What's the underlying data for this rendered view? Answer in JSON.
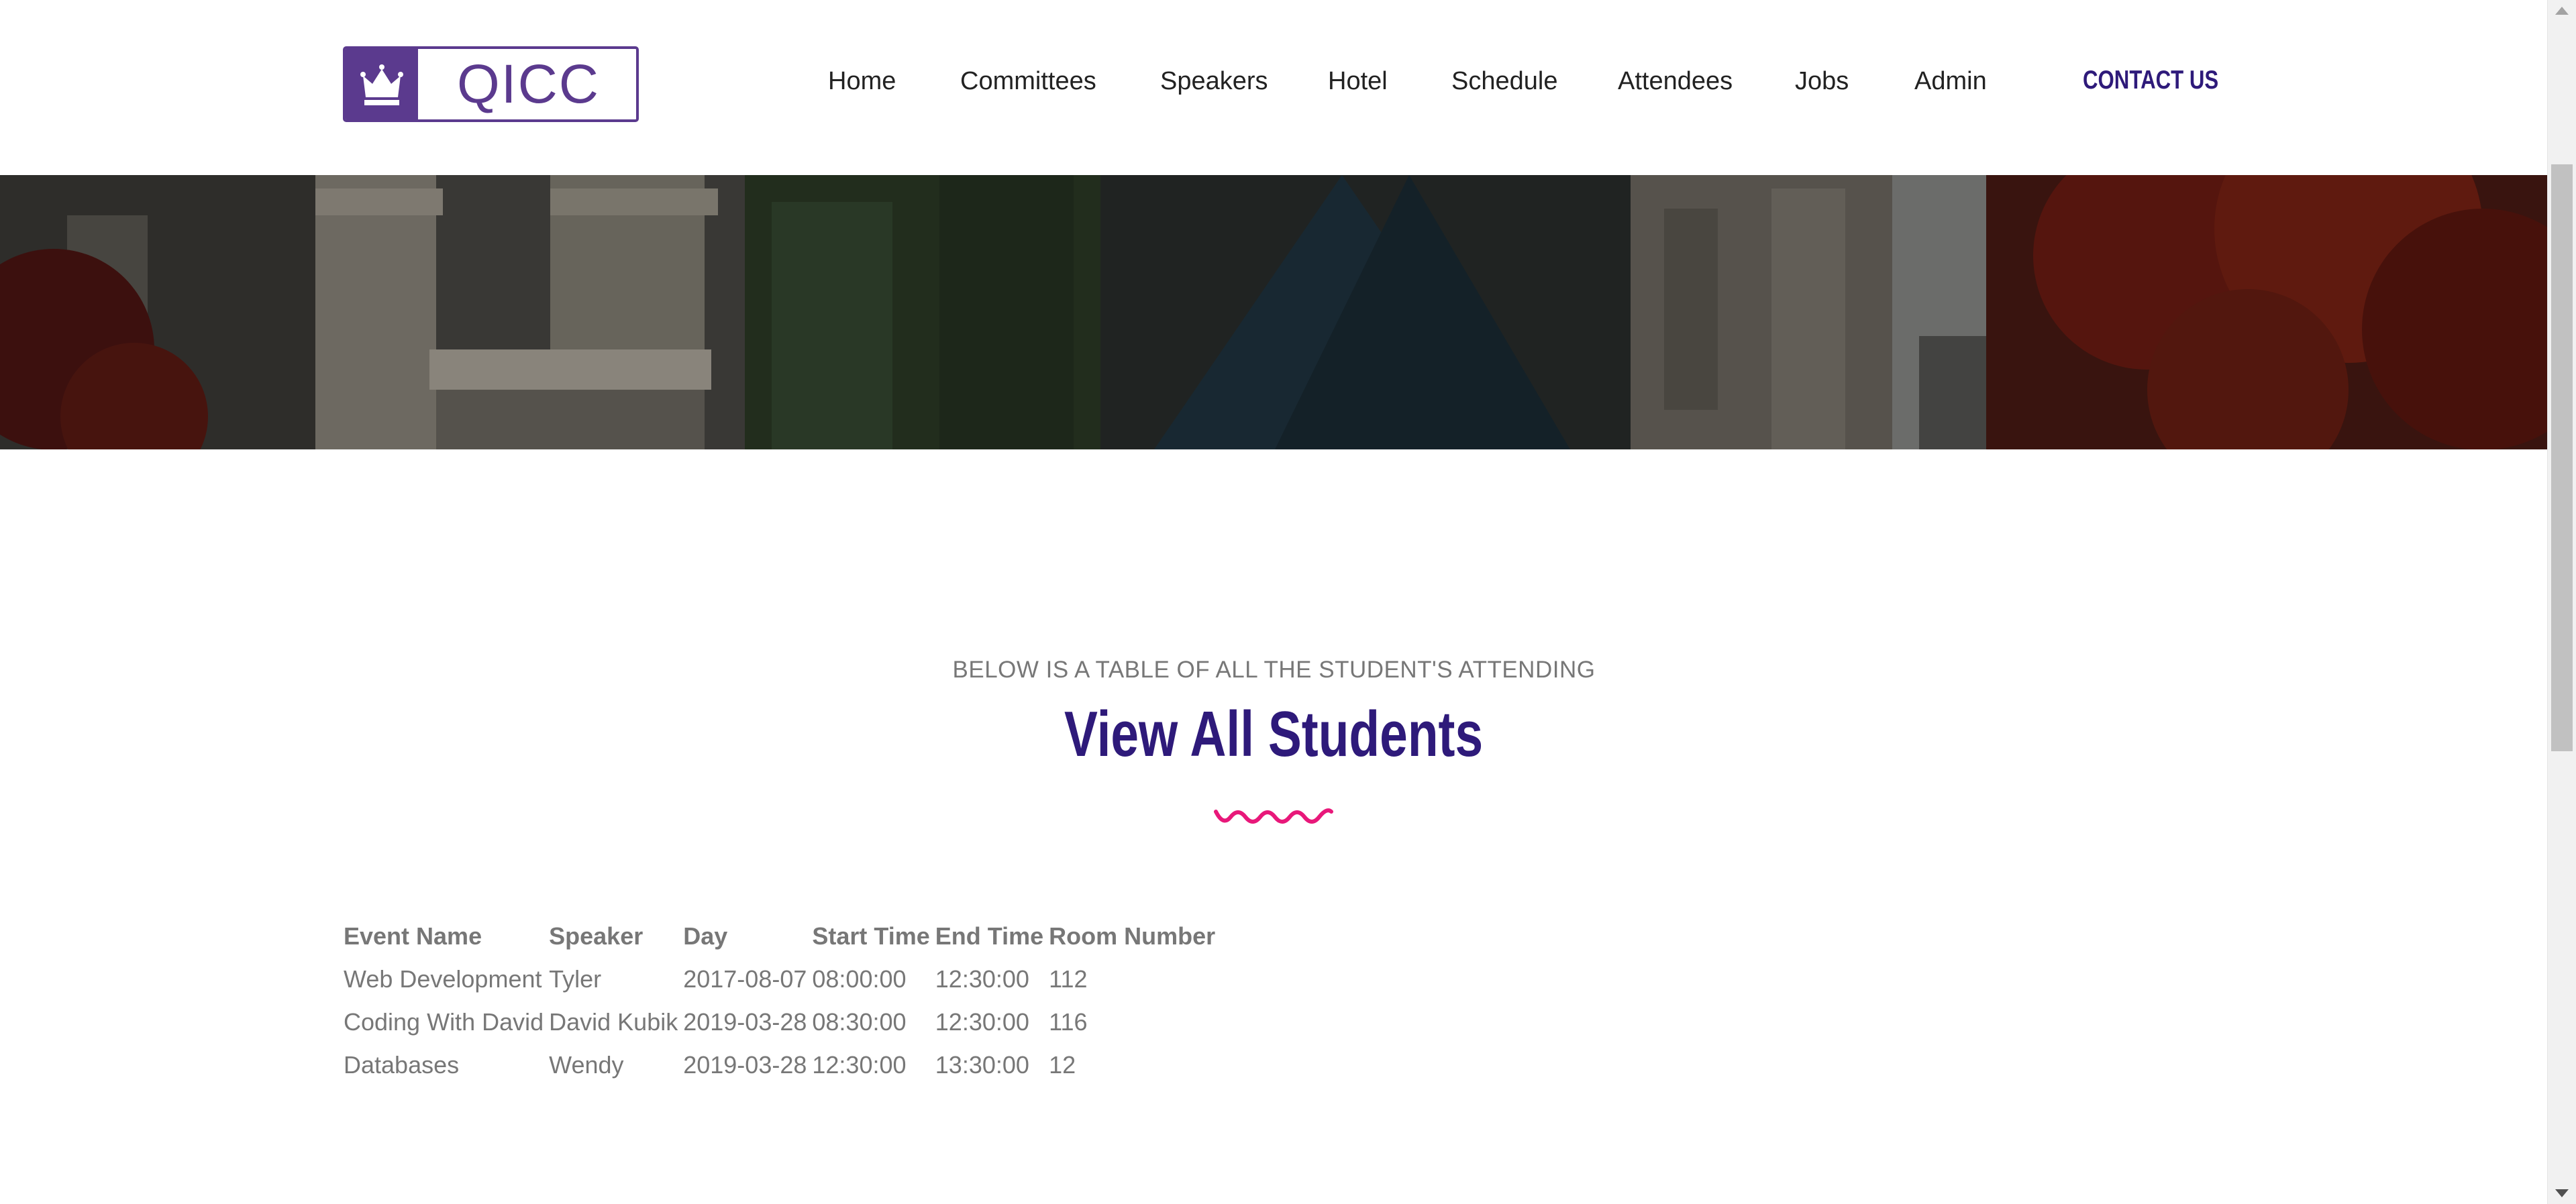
{
  "header": {
    "logo_text": "QICC",
    "nav": [
      {
        "label": "Home"
      },
      {
        "label": "Committees"
      },
      {
        "label": "Speakers"
      },
      {
        "label": "Hotel"
      },
      {
        "label": "Schedule"
      },
      {
        "label": "Attendees"
      },
      {
        "label": "Jobs"
      },
      {
        "label": "Admin"
      }
    ],
    "contact_label": "CONTACT US"
  },
  "section": {
    "kicker": "BELOW IS A TABLE OF ALL THE STUDENT'S ATTENDING",
    "title": "View All Students"
  },
  "table": {
    "headers": [
      "Event Name",
      "Speaker",
      "Day",
      "Start Time",
      "End Time",
      "Room Number"
    ],
    "rows": [
      [
        "Web Development",
        "Tyler",
        "2017-08-07",
        "08:00:00",
        "12:30:00",
        "112"
      ],
      [
        "Coding With David",
        "David Kubik",
        "2019-03-28",
        "08:30:00",
        "12:30:00",
        "116"
      ],
      [
        "Databases",
        "Wendy",
        "2019-03-28",
        "12:30:00",
        "13:30:00",
        "12"
      ]
    ]
  },
  "colors": {
    "brand": "#5b3a8e",
    "title": "#2e1a7a",
    "accent_wave": "#e8187a",
    "text": "#777777"
  },
  "icons": {
    "logo": "crown-icon",
    "divider": "wave-divider-icon"
  }
}
